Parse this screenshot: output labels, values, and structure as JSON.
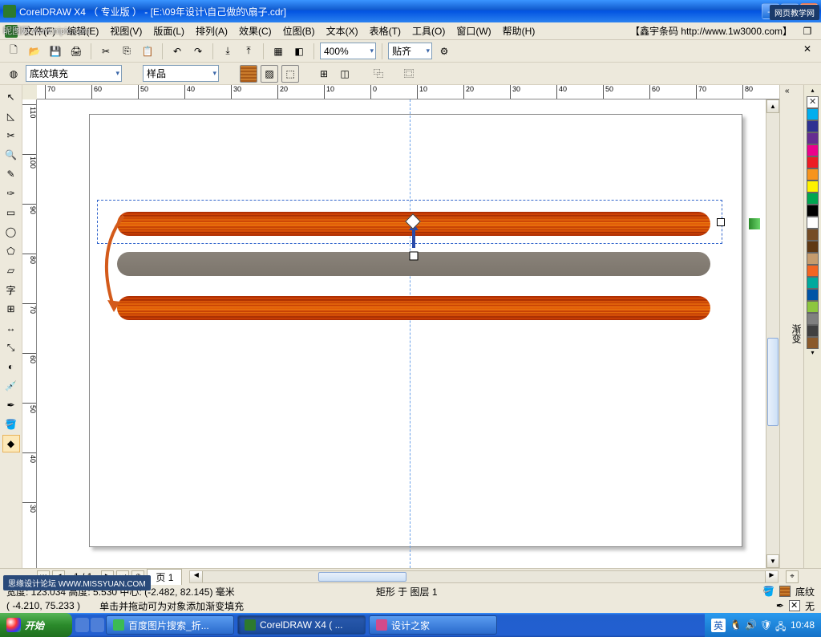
{
  "window": {
    "title": "CorelDRAW X4 （ 专业版 ） - [E:\\09年设计\\自己做的\\扇子.cdr]",
    "watermark_tr": "网页教学网",
    "watermark_tl": "昵图网 www.nipic.com",
    "watermark_bl": "思缘设计论坛 WWW.MISSYUAN.COM"
  },
  "menu": {
    "file": "文件(F)",
    "edit": "编辑(E)",
    "view": "视图(V)",
    "layout": "版面(L)",
    "arrange": "排列(A)",
    "effect": "效果(C)",
    "bitmap": "位图(B)",
    "text": "文本(X)",
    "table": "表格(T)",
    "tool": "工具(O)",
    "window": "窗口(W)",
    "help": "帮助(H)",
    "extra": "【鑫宇条码 http://www.1w3000.com】"
  },
  "toolbar": {
    "zoom": "400%",
    "snap": "贴齐"
  },
  "prop": {
    "filltype": "底纹填充",
    "sample": "样品"
  },
  "ruler": {
    "h": [
      "70",
      "60",
      "50",
      "40",
      "30",
      "20",
      "10",
      "0",
      "10",
      "20",
      "30",
      "40",
      "50",
      "60",
      "70",
      "80"
    ],
    "v": [
      "110",
      "100",
      "90",
      "80",
      "70",
      "60",
      "50",
      "40",
      "30"
    ]
  },
  "docker": {
    "label": "渐变"
  },
  "pager": {
    "pages": "1 / 1",
    "tab": "页 1"
  },
  "status": {
    "dim": "宽度: 123.034  高度: 5.530  中心: (-2.482, 82.145) 毫米",
    "obj": "矩形 于 图层 1",
    "fillname": "底纹",
    "coord": "( -4.210, 75.233 )",
    "hint": "单击并拖动可为对象添加渐变填充",
    "outline": "无"
  },
  "task": {
    "start": "开始",
    "t1": "百度图片搜索_折...",
    "t2": "CorelDRAW X4 ( ...",
    "t3": "设计之家"
  },
  "tray": {
    "clock": "10:48",
    "lang": "英"
  },
  "palette": [
    "#00aeef",
    "#2e3192",
    "#662d91",
    "#ec008c",
    "#ed1c24",
    "#f7941d",
    "#fff200",
    "#00a651",
    "#000000",
    "#ffffff",
    "#754c24",
    "#603913",
    "#c69c6d",
    "#f26522",
    "#00a99d",
    "#0054a6",
    "#8dc63f",
    "#808080",
    "#404040",
    "#8B5A2B"
  ]
}
